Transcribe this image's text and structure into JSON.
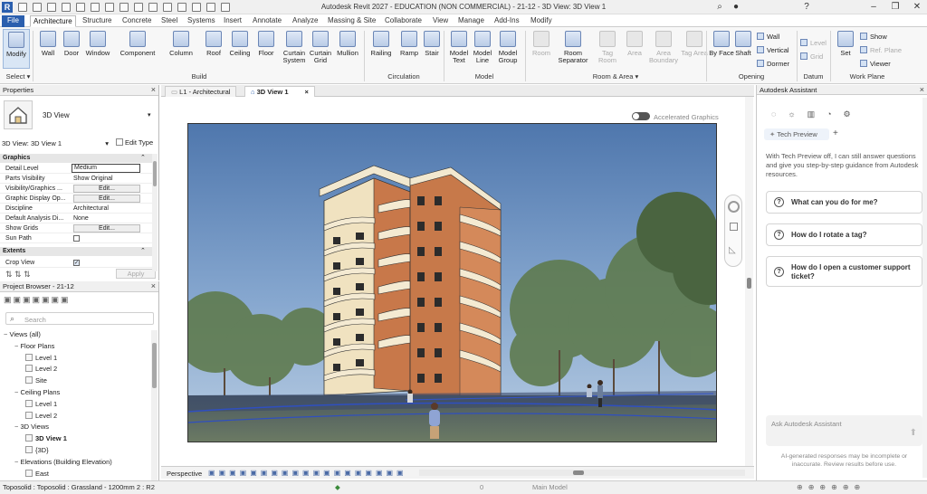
{
  "app": {
    "title": "Autodesk Revit 2027 - EDUCATION (NON COMMERCIAL) - 21-12 - 3D View: 3D View 1",
    "logo": "R"
  },
  "menu": [
    "File",
    "Architecture",
    "Structure",
    "Concrete",
    "Steel",
    "Systems",
    "Insert",
    "Annotate",
    "Analyze",
    "Massing & Site",
    "Collaborate",
    "View",
    "Manage",
    "Add-Ins",
    "Modify"
  ],
  "ribbon": {
    "buttons": [
      {
        "label": "Modify",
        "icon": "cursor-icon"
      },
      {
        "label": "Wall",
        "icon": "wall-icon"
      },
      {
        "label": "Door",
        "icon": "door-icon"
      },
      {
        "label": "Window",
        "icon": "window-icon"
      },
      {
        "label": "Component",
        "icon": "component-icon"
      },
      {
        "label": "Column",
        "icon": "column-icon"
      },
      {
        "label": "Roof",
        "icon": "roof-icon"
      },
      {
        "label": "Ceiling",
        "icon": "ceiling-icon"
      },
      {
        "label": "Floor",
        "icon": "floor-icon"
      },
      {
        "label": "Curtain System",
        "icon": "curtain-system-icon"
      },
      {
        "label": "Curtain Grid",
        "icon": "curtain-grid-icon"
      },
      {
        "label": "Mullion",
        "icon": "mullion-icon"
      },
      {
        "label": "Railing",
        "icon": "railing-icon"
      },
      {
        "label": "Ramp",
        "icon": "ramp-icon"
      },
      {
        "label": "Stair",
        "icon": "stair-icon"
      },
      {
        "label": "Model Text",
        "icon": "model-text-icon"
      },
      {
        "label": "Model Line",
        "icon": "model-line-icon"
      },
      {
        "label": "Model Group",
        "icon": "model-group-icon"
      },
      {
        "label": "Room",
        "icon": "room-icon"
      },
      {
        "label": "Room Separator",
        "icon": "room-separator-icon"
      },
      {
        "label": "Tag Room",
        "icon": "tag-room-icon"
      },
      {
        "label": "Area",
        "icon": "area-icon"
      },
      {
        "label": "Area Boundary",
        "icon": "area-boundary-icon"
      },
      {
        "label": "Tag Area",
        "icon": "tag-area-icon"
      },
      {
        "label": "By Face",
        "icon": "by-face-icon"
      },
      {
        "label": "Shaft",
        "icon": "shaft-icon"
      },
      {
        "label": "Set",
        "icon": "set-icon"
      }
    ],
    "small": {
      "wall": "Wall",
      "vertical": "Vertical",
      "dormer": "Dormer",
      "level": "Level",
      "grid": "Grid",
      "show": "Show",
      "ref_plane": "Ref. Plane",
      "viewer": "Viewer"
    },
    "groups": {
      "select": "Select ▾",
      "build": "Build",
      "circulation": "Circulation",
      "model": "Model",
      "room_area": "Room & Area ▾",
      "opening": "Opening",
      "datum": "Datum",
      "work_plane": "Work Plane"
    }
  },
  "properties": {
    "title": "Properties",
    "type_name": "3D View",
    "view_selector": "3D View: 3D View 1",
    "edit_type": "Edit Type",
    "sections": {
      "graphics": "Graphics",
      "extents": "Extents"
    },
    "rows": [
      {
        "k": "Detail Level",
        "v": "Medium"
      },
      {
        "k": "Parts Visibility",
        "v": "Show Original"
      },
      {
        "k": "Visibility/Graphics ...",
        "v": "Edit..."
      },
      {
        "k": "Graphic Display Op...",
        "v": "Edit..."
      },
      {
        "k": "Discipline",
        "v": "Architectural"
      },
      {
        "k": "Default Analysis Di...",
        "v": "None"
      },
      {
        "k": "Show Grids",
        "v": "Edit..."
      },
      {
        "k": "Sun Path",
        "v": ""
      }
    ],
    "crop_view": "Crop View",
    "apply": "Apply"
  },
  "browser": {
    "title": "Project Browser - 21-12",
    "search_placeholder": "Search",
    "tree": [
      {
        "label": "Views (all)",
        "level": 0,
        "bold": false
      },
      {
        "label": "Floor Plans",
        "level": 1
      },
      {
        "label": "Level 1",
        "level": 2
      },
      {
        "label": "Level 2",
        "level": 2
      },
      {
        "label": "Site",
        "level": 2
      },
      {
        "label": "Ceiling Plans",
        "level": 1
      },
      {
        "label": "Level 1",
        "level": 2
      },
      {
        "label": "Level 2",
        "level": 2
      },
      {
        "label": "3D Views",
        "level": 1
      },
      {
        "label": "3D View 1",
        "level": 2,
        "bold": true
      },
      {
        "label": "{3D}",
        "level": 2
      },
      {
        "label": "Elevations (Building Elevation)",
        "level": 1
      },
      {
        "label": "East",
        "level": 2
      }
    ]
  },
  "view_tabs": [
    {
      "label": "L1 - Architectural",
      "active": false
    },
    {
      "label": "3D View 1",
      "active": true
    }
  ],
  "viewport": {
    "accelerated_graphics": "Accelerated Graphics",
    "view_mode": "Perspective"
  },
  "assistant": {
    "title": "Autodesk Assistant",
    "tech_tab": "Tech Preview",
    "intro": "With Tech Preview off, I can still answer questions and give you step-by-step guidance from Autodesk resources.",
    "questions": [
      "What can you do for me?",
      "How do I rotate a tag?",
      "How do I open a customer support ticket?"
    ],
    "ask_placeholder": "Ask Autodesk Assistant",
    "disclaimer": "AI-generated responses may be incomplete or inaccurate. Review results before use."
  },
  "status": {
    "selection": "Toposolid : Toposolid : Grassland - 1200mm 2 : R2",
    "count": "0",
    "model": "Main Model"
  },
  "colors": {
    "accent": "#2b5fae",
    "sky": "#6a8fbd",
    "brick": "#c87a48",
    "grass": "#5d6e5a"
  }
}
